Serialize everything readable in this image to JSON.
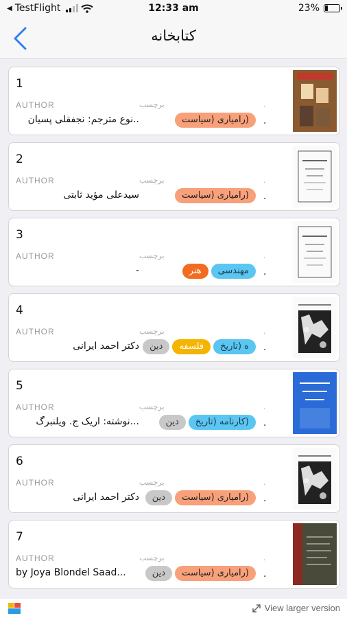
{
  "status_bar": {
    "carrier": "TestFlight",
    "time": "12:33 am",
    "battery_percent": "23%",
    "battery_level": 0.23
  },
  "nav": {
    "title": "کتابخانه"
  },
  "labels": {
    "author": "AUTHOR",
    "tag": "برچسب"
  },
  "books": [
    {
      "number": "1",
      "author": "..نوع مترجم: نجفقلی پسیان",
      "tags": [
        {
          "label": "(رامیاری (سیاست",
          "color": "orange"
        }
      ],
      "cover_color": "#a86a3a"
    },
    {
      "number": "2",
      "author": "سیدعلی مؤید ثابتی",
      "tags": [
        {
          "label": "(رامیاری (سیاست",
          "color": "orange"
        }
      ],
      "cover_color": "#ffffff"
    },
    {
      "number": "3",
      "author": "-",
      "tags": [
        {
          "label": "مهندسی",
          "color": "blue"
        },
        {
          "label": "هنر",
          "color": "red"
        }
      ],
      "cover_color": "#ffffff"
    },
    {
      "number": "4",
      "author": "دکتر احمد ایرانی",
      "tags": [
        {
          "label": "ه (تاریخ",
          "color": "blue"
        },
        {
          "label": "فلسفه",
          "color": "yellow"
        },
        {
          "label": "دین",
          "color": "gray"
        }
      ],
      "cover_color": "#222222"
    },
    {
      "number": "5",
      "author": "...نوشته: اریک ج. ویلنبرگ",
      "tags": [
        {
          "label": "(کارنامه (تاریخ",
          "color": "blue"
        },
        {
          "label": "دین",
          "color": "gray"
        }
      ],
      "cover_color": "#2a6bd8"
    },
    {
      "number": "6",
      "author": "دکتر احمد ایرانی",
      "tags": [
        {
          "label": "(رامیاری (سیاست",
          "color": "orange"
        },
        {
          "label": "دین",
          "color": "gray"
        }
      ],
      "cover_color": "#222222"
    },
    {
      "number": "7",
      "author": "by Joya Blondel Saad...",
      "tags": [
        {
          "label": "(رامیاری (سیاست",
          "color": "orange"
        },
        {
          "label": "دین",
          "color": "gray"
        }
      ],
      "cover_color": "#8a2a20"
    }
  ],
  "footer": {
    "larger_version": "View larger version"
  }
}
